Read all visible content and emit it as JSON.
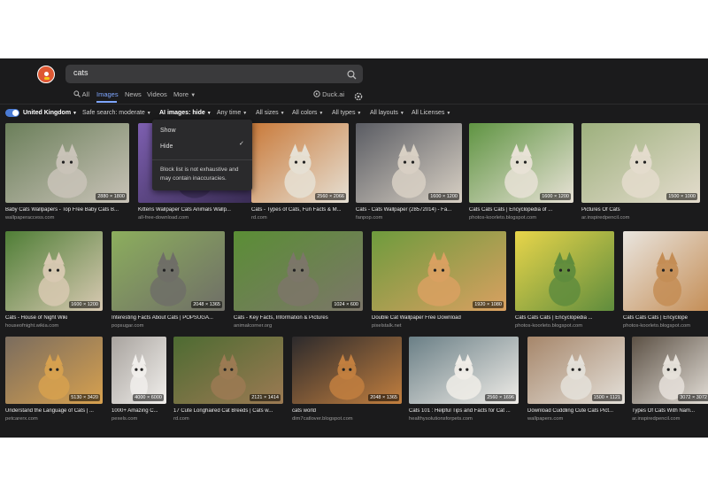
{
  "search": {
    "query": "cats"
  },
  "tabs": [
    {
      "label": "All",
      "icon": "search-icon",
      "active": false
    },
    {
      "label": "Images",
      "active": true
    },
    {
      "label": "News",
      "active": false
    },
    {
      "label": "Videos",
      "active": false
    },
    {
      "label": "More",
      "active": false
    }
  ],
  "duck_ai": "Duck.ai",
  "filters": {
    "region": "United Kingdom",
    "safe_search": "Safe search: moderate",
    "ai_images": "AI images: hide",
    "time": "Any time",
    "sizes": "All sizes",
    "colors": "All colors",
    "types": "All types",
    "layouts": "All layouts",
    "licenses": "All Licenses"
  },
  "ai_dropdown": {
    "options": [
      "Show",
      "Hide"
    ],
    "selected": "Hide",
    "note": "Block list is not exhaustive and may contain inaccuracies."
  },
  "colors": {
    "accent": "#7ea6ff",
    "background": "#1b1b1c",
    "brand": "#de5833"
  },
  "results": [
    {
      "title": "Baby Cats Wallpapers - Top Free Baby Cats B...",
      "source": "wallpaperaccess.com",
      "dims": "2880 × 1800"
    },
    {
      "title": "Kittens Wallpaper Cats Animals Wallp...",
      "source": "all-free-download.com",
      "dims": ""
    },
    {
      "title": "Cats - Types of Cats, Fun Facts & M...",
      "source": "rd.com",
      "dims": "2560 × 2066"
    },
    {
      "title": "Cats - Cats Wallpaper (28572014) - Fa...",
      "source": "fanpop.com",
      "dims": "1600 × 1200"
    },
    {
      "title": "Cats Cats Cats | Encyclopedia of ...",
      "source": "photos-koorleto.blogspot.com",
      "dims": "1600 × 1200"
    },
    {
      "title": "Pictures Of Cats",
      "source": "ar.inspiredpencil.com",
      "dims": "1500 × 1000"
    },
    {
      "title": "Cats - House of Night Wiki",
      "source": "houseofnight.wikia.com",
      "dims": "1600 × 1200"
    },
    {
      "title": "Interesting Facts About Cats | POPSUGA...",
      "source": "popsugar.com",
      "dims": "2048 × 1365"
    },
    {
      "title": "Cats - Key Facts, Information & Pictures",
      "source": "animalcorner.org",
      "dims": "1024 × 600"
    },
    {
      "title": "Double Cat Wallpaper Free Download",
      "source": "pixelstalk.net",
      "dims": "1920 × 1080"
    },
    {
      "title": "Cats Cats Cats | Encyclopedia ...",
      "source": "photos-koorleto.blogspot.com",
      "dims": ""
    },
    {
      "title": "Cats Cats Cats | Encyclope",
      "source": "photos-koorleto.blogspot.com",
      "dims": ""
    },
    {
      "title": "Understand the Language of Cats | ...",
      "source": "petcarerx.com",
      "dims": "5130 × 3420"
    },
    {
      "title": "1000+ Amazing C...",
      "source": "pexels.com",
      "dims": "4000 × 6000"
    },
    {
      "title": "17 Cute Longhaired Cat Breeds | Cats w...",
      "source": "rd.com",
      "dims": "2121 × 1414"
    },
    {
      "title": "cats world",
      "source": "dim7catlover.blogspot.com",
      "dims": "2048 × 1365"
    },
    {
      "title": "Cats 101 : Helpful Tips and Facts for Cat ...",
      "source": "healthysolutionsforpets.com",
      "dims": "2560 × 1696"
    },
    {
      "title": "Download Cuddling Cute Cats Pict...",
      "source": "wallpapers.com",
      "dims": "1500 × 1121"
    },
    {
      "title": "Types Of Cats With Nam...",
      "source": "ar.inspiredpencil.com",
      "dims": "3072 × 3072"
    }
  ]
}
